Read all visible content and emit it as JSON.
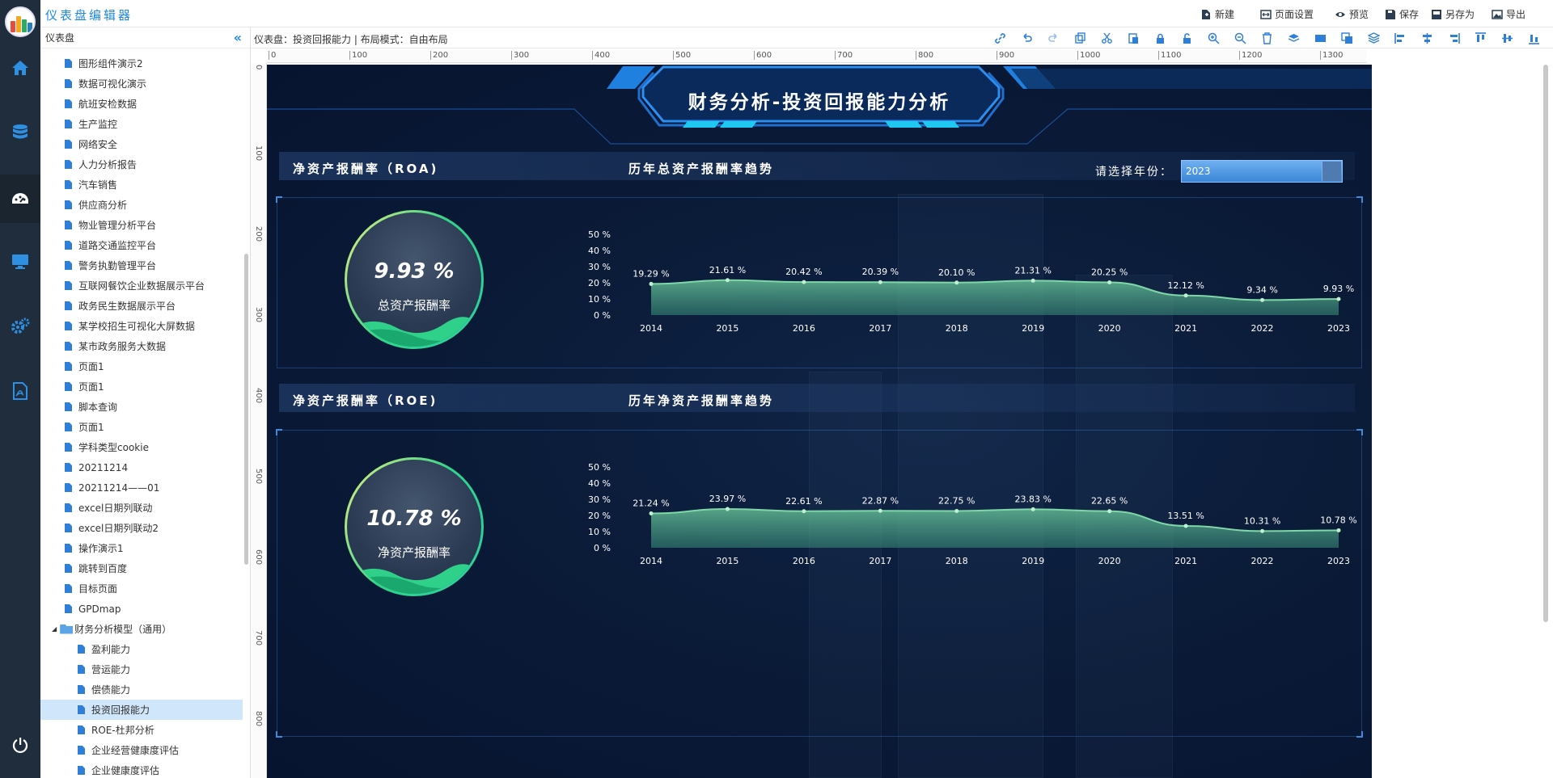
{
  "app": {
    "title": "仪表盘编辑器"
  },
  "toolbar": {
    "new": "新建",
    "page_settings": "页面设置",
    "preview": "预览",
    "save": "保存",
    "save_as": "另存为",
    "export": "导出"
  },
  "tree": {
    "title": "仪表盘",
    "items": [
      {
        "label": "图形组件演示2"
      },
      {
        "label": "数据可视化演示"
      },
      {
        "label": "航班安检数据"
      },
      {
        "label": "生产监控"
      },
      {
        "label": "网络安全"
      },
      {
        "label": "人力分析报告"
      },
      {
        "label": "汽车销售"
      },
      {
        "label": "供应商分析"
      },
      {
        "label": "物业管理分析平台"
      },
      {
        "label": "道路交通监控平台"
      },
      {
        "label": "警务执勤管理平台"
      },
      {
        "label": "互联网餐饮企业数据展示平台"
      },
      {
        "label": "政务民生数据展示平台"
      },
      {
        "label": "某学校招生可视化大屏数据"
      },
      {
        "label": "某市政务服务大数据"
      },
      {
        "label": "页面1"
      },
      {
        "label": "页面1"
      },
      {
        "label": "脚本查询"
      },
      {
        "label": "页面1"
      },
      {
        "label": "学科类型cookie"
      },
      {
        "label": "20211214"
      },
      {
        "label": "20211214——01"
      },
      {
        "label": "excel日期列联动"
      },
      {
        "label": "excel日期列联动2"
      },
      {
        "label": "操作演示1"
      },
      {
        "label": "跳转到百度"
      },
      {
        "label": "目标页面"
      },
      {
        "label": "GPDmap"
      }
    ],
    "folder": {
      "label": "财务分析模型（通用）"
    },
    "children": [
      {
        "label": "盈利能力",
        "sub": false
      },
      {
        "label": "营运能力",
        "sub": false
      },
      {
        "label": "偿债能力",
        "sub": false
      },
      {
        "label": "投资回报能力",
        "sub": false,
        "selected": true
      },
      {
        "label": "ROE-杜邦分析",
        "sub": false
      },
      {
        "label": "企业经营健康度评估",
        "sub": false
      },
      {
        "label": "企业健康度评估",
        "sub": false
      }
    ]
  },
  "workspace": {
    "breadcrumb": "仪表盘：投资回报能力 | 布局模式：自由布局"
  },
  "ruler": {
    "h_labels": [
      "0",
      "100",
      "200",
      "300",
      "400",
      "500",
      "600",
      "700",
      "800",
      "900",
      "1000",
      "1100",
      "1200",
      "1300"
    ],
    "v_labels": [
      "0",
      "100",
      "200",
      "300",
      "400",
      "500",
      "600",
      "700",
      "800"
    ]
  },
  "dashboard": {
    "title": "财务分析-投资回报能力分析",
    "year_label": "请选择年份：",
    "year_value": "2023",
    "roa": {
      "section_title": "净资产报酬率（ROA)",
      "trend_title": "历年总资产报酬率趋势",
      "gauge_value": "9.93 %",
      "gauge_label": "总资产报酬率"
    },
    "roe": {
      "section_title": "净资产报酬率（ROE)",
      "trend_title": "历年净资产报酬率趋势",
      "gauge_value": "10.78 %",
      "gauge_label": "净资产报酬率"
    }
  },
  "chart_data": [
    {
      "type": "area",
      "title": "历年总资产报酬率趋势",
      "x": [
        "2014",
        "2015",
        "2016",
        "2017",
        "2018",
        "2019",
        "2020",
        "2021",
        "2022",
        "2023"
      ],
      "series": [
        {
          "values": [
            19.29,
            21.61,
            20.42,
            20.39,
            20.1,
            21.31,
            20.25,
            12.12,
            9.34,
            9.93
          ]
        }
      ],
      "labels": [
        "19.29 %",
        "21.61 %",
        "20.42 %",
        "20.39 %",
        "20.10 %",
        "21.31 %",
        "20.25 %",
        "12.12 %",
        "9.34 %",
        "9.93 %"
      ],
      "yticks": [
        "0 %",
        "10 %",
        "20 %",
        "30 %",
        "40 %",
        "50 %"
      ],
      "ylim": [
        0,
        50
      ],
      "color": "#7fd7a8"
    },
    {
      "type": "area",
      "title": "历年净资产报酬率趋势",
      "x": [
        "2014",
        "2015",
        "2016",
        "2017",
        "2018",
        "2019",
        "2020",
        "2021",
        "2022",
        "2023"
      ],
      "series": [
        {
          "values": [
            21.24,
            23.97,
            22.61,
            22.87,
            22.75,
            23.83,
            22.65,
            13.51,
            10.31,
            10.78
          ]
        }
      ],
      "labels": [
        "21.24 %",
        "23.97 %",
        "22.61 %",
        "22.87 %",
        "22.75 %",
        "23.83 %",
        "22.65 %",
        "13.51 %",
        "10.31 %",
        "10.78 %"
      ],
      "yticks": [
        "0 %",
        "10 %",
        "20 %",
        "30 %",
        "40 %",
        "50 %"
      ],
      "ylim": [
        0,
        50
      ],
      "color": "#7fd7a8"
    }
  ]
}
